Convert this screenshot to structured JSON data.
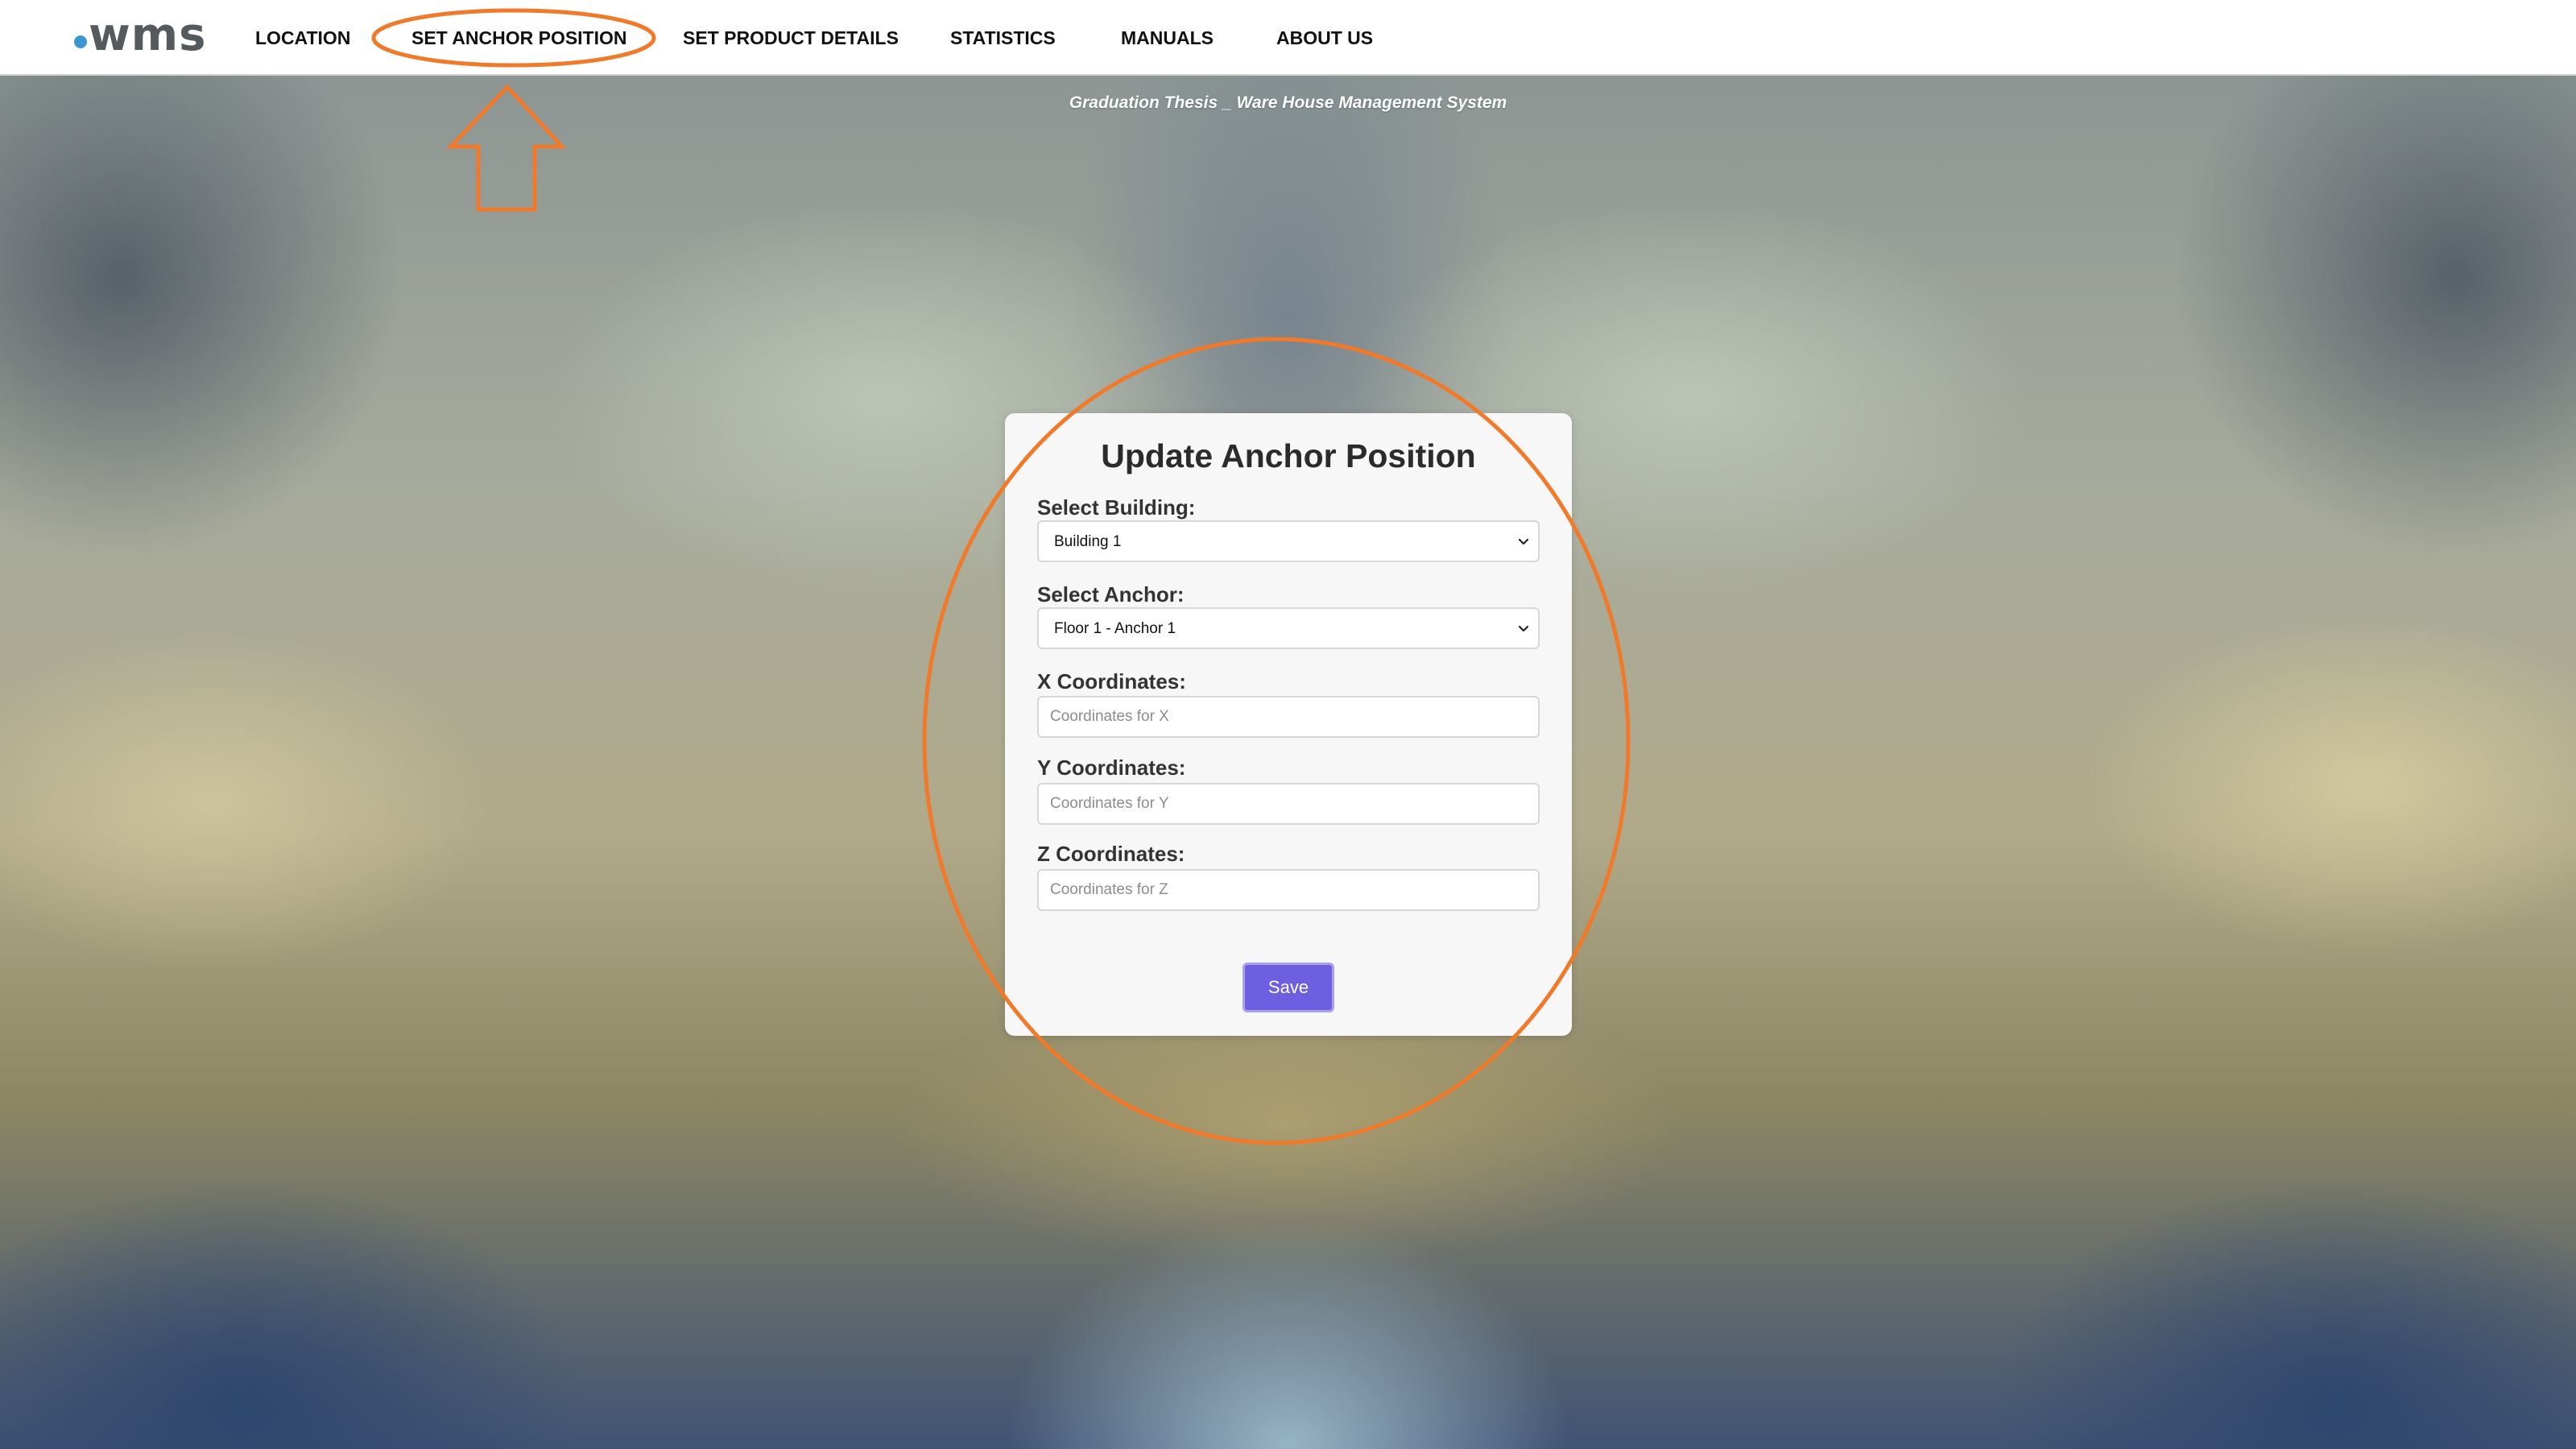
{
  "logo": {
    "text": "wms"
  },
  "nav": {
    "items": [
      {
        "label": "LOCATION"
      },
      {
        "label": "SET ANCHOR POSITION"
      },
      {
        "label": "SET PRODUCT DETAILS"
      },
      {
        "label": "STATISTICS"
      },
      {
        "label": "MANUALS"
      },
      {
        "label": "ABOUT US"
      }
    ],
    "active_index": 1
  },
  "subtitle": "Graduation Thesis _ Ware House Management System",
  "form": {
    "title": "Update Anchor Position",
    "building": {
      "label": "Select Building:",
      "selected": "Building 1"
    },
    "anchor": {
      "label": "Select Anchor:",
      "selected": "Floor 1 - Anchor 1"
    },
    "x": {
      "label": "X Coordinates:",
      "placeholder": "Coordinates for X",
      "value": ""
    },
    "y": {
      "label": "Y Coordinates:",
      "placeholder": "Coordinates for Y",
      "value": ""
    },
    "z": {
      "label": "Z Coordinates:",
      "placeholder": "Coordinates for Z",
      "value": ""
    },
    "save_label": "Save"
  },
  "colors": {
    "logo_dot": "#3a97d3",
    "logo_text": "#555a5e",
    "button": "#6e5ee0",
    "annotation": "#f07a2a"
  },
  "icons": {
    "select_chevron": "chevron-down-icon",
    "annotation_arrow": "arrow-up-icon"
  }
}
